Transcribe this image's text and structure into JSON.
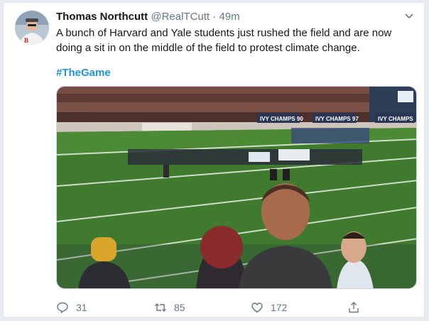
{
  "author": {
    "name": "Thomas Northcutt",
    "handle": "@RealTCutt",
    "separator": "·",
    "time": "49m"
  },
  "tweet": {
    "text": "A bunch of Harvard and Yale students just rushed the field and are now doing a sit in on the middle of the field to protest climate change.",
    "hashtag": "#TheGame"
  },
  "media": {
    "signs": [
      "IVY CHAMPS 90",
      "IVY CHAMPS 97",
      "IVY CHAMPS"
    ]
  },
  "actions": {
    "replies": "31",
    "retweets": "85",
    "likes": "172"
  },
  "icons": {
    "reply": "reply-icon",
    "retweet": "retweet-icon",
    "like": "heart-icon",
    "share": "share-icon",
    "menu": "chevron-down-icon"
  },
  "colors": {
    "link": "#1b95e0",
    "muted": "#657786",
    "text": "#14171a"
  }
}
